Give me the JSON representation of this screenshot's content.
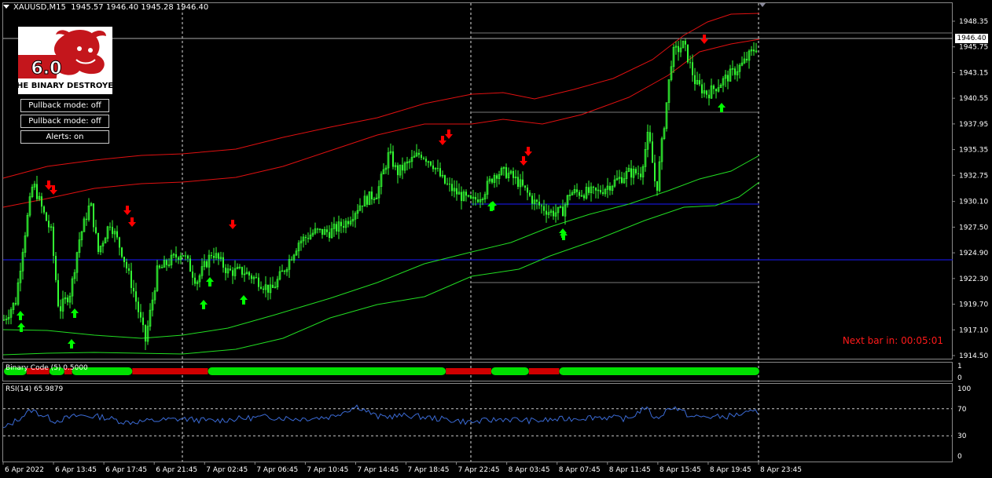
{
  "header": {
    "symbol": "XAUUSD,M15",
    "ohlc": "1945.57 1946.40 1945.28 1946.40"
  },
  "logo": {
    "version": "6.0",
    "brand_text": "THE BINARY DESTROYER"
  },
  "buttons": {
    "pullback1": "Pullback mode: off",
    "pullback2": "Pullback mode: off",
    "alerts": "Alerts: on"
  },
  "current_price": "1946.40",
  "next_bar": "Next bar in: 00:05:01",
  "price_axis": {
    "ticks": [
      "1948.35",
      "1945.75",
      "1943.15",
      "1940.55",
      "1937.95",
      "1935.35",
      "1932.75",
      "1930.10",
      "1927.50",
      "1924.90",
      "1922.30",
      "1919.70",
      "1917.10",
      "1914.50"
    ],
    "min": 1914.5,
    "max": 1948.35
  },
  "time_axis": [
    "6 Apr 2022",
    "6 Apr 13:45",
    "6 Apr 17:45",
    "6 Apr 21:45",
    "7 Apr 02:45",
    "7 Apr 06:45",
    "7 Apr 10:45",
    "7 Apr 14:45",
    "7 Apr 18:45",
    "7 Apr 22:45",
    "8 Apr 03:45",
    "8 Apr 07:45",
    "8 Apr 11:45",
    "8 Apr 15:45",
    "8 Apr 19:45",
    "8 Apr 23:45"
  ],
  "binary_panel": {
    "label": "Binary Code (5) 0.5000",
    "ticks": [
      "1",
      "0"
    ],
    "segments": [
      {
        "color": "green",
        "end": 0.03
      },
      {
        "color": "red",
        "end": 0.06
      },
      {
        "color": "green",
        "end": 0.08
      },
      {
        "color": "red",
        "end": 0.09
      },
      {
        "color": "green",
        "end": 0.17
      },
      {
        "color": "red",
        "end": 0.27
      },
      {
        "color": "green",
        "end": 0.585
      },
      {
        "color": "red",
        "end": 0.645
      },
      {
        "color": "green",
        "end": 0.695
      },
      {
        "color": "red",
        "end": 0.735
      },
      {
        "color": "green",
        "end": 1.0
      }
    ]
  },
  "rsi_panel": {
    "label": "RSI(14) 65.9879",
    "ticks": [
      "100",
      "70",
      "30",
      "0"
    ],
    "levels": [
      70,
      30
    ]
  },
  "colors": {
    "candle": "#33ff33",
    "band_red": "#e01010",
    "band_green": "#22dd22",
    "hline_blue": "#1a1aff",
    "arrow_up": "#00ff00",
    "arrow_down": "#ff0000",
    "rsi_line": "#3b6bd6",
    "accent_red": "#ff1a1a"
  }
}
